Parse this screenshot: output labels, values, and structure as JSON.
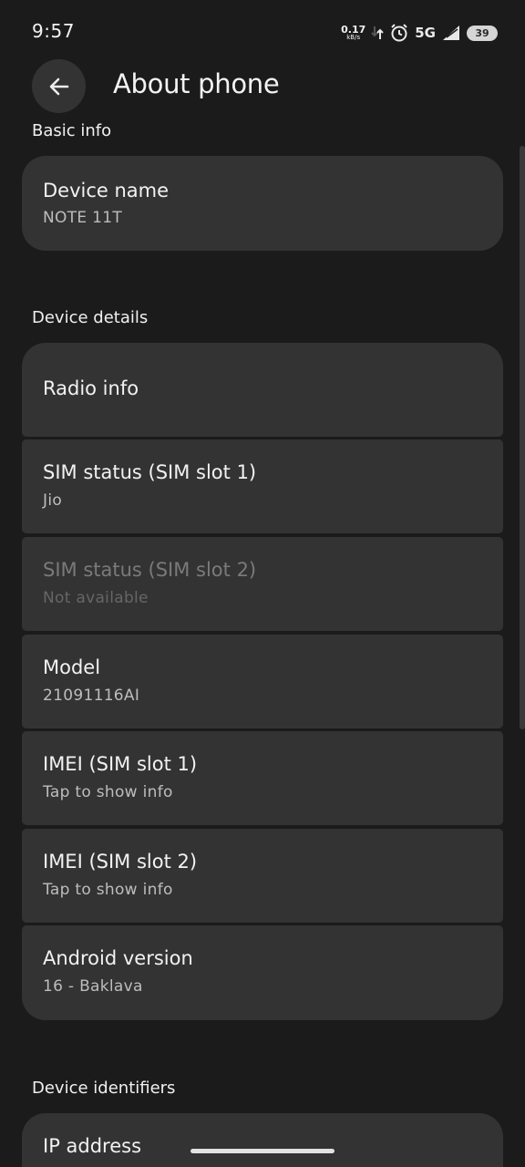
{
  "status_bar": {
    "time": "9:57",
    "net_speed_value": "0.17",
    "net_speed_unit": "kB/s",
    "network": "5G",
    "battery": "39"
  },
  "header": {
    "title": "About phone"
  },
  "sections": {
    "basic_info": {
      "header": "Basic info",
      "device_name": {
        "title": "Device name",
        "value": "NOTE 11T"
      }
    },
    "device_details": {
      "header": "Device details",
      "radio_info": {
        "title": "Radio info"
      },
      "sim_status_1": {
        "title": "SIM status (SIM slot 1)",
        "value": "Jio"
      },
      "sim_status_2": {
        "title": "SIM status (SIM slot 2)",
        "value": "Not available"
      },
      "model": {
        "title": "Model",
        "value": "21091116AI"
      },
      "imei_1": {
        "title": "IMEI (SIM slot 1)",
        "value": "Tap to show info"
      },
      "imei_2": {
        "title": "IMEI (SIM slot 2)",
        "value": "Tap to show info"
      },
      "android_version": {
        "title": "Android version",
        "value": "16 - Baklava"
      }
    },
    "device_identifiers": {
      "header": "Device identifiers",
      "ip_address": {
        "title": "IP address"
      }
    }
  },
  "colors": {
    "background": "#1b1b1b",
    "card": "#333333",
    "text_primary": "#f2f2f2",
    "text_secondary": "#bdbdbd",
    "text_disabled": "#7a7a7a"
  }
}
